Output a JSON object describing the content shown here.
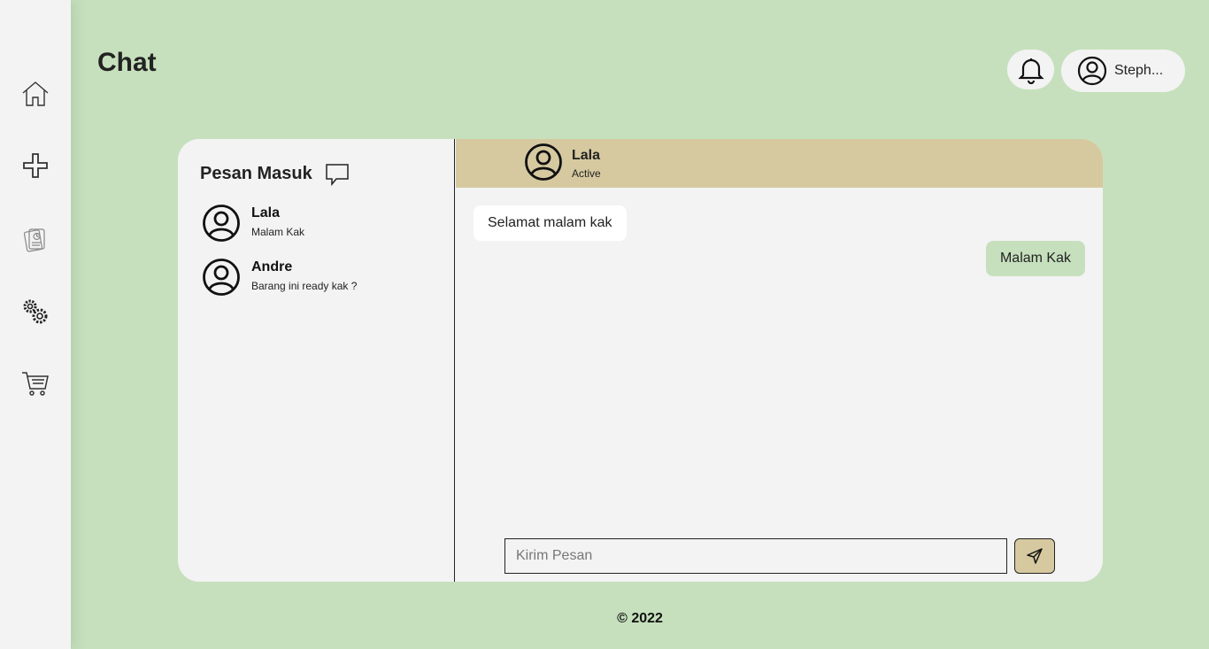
{
  "header": {
    "title": "Chat",
    "user_name": "Steph..."
  },
  "sidebar": {
    "items": [
      {
        "icon": "home-icon"
      },
      {
        "icon": "plus-icon"
      },
      {
        "icon": "orders-icon"
      },
      {
        "icon": "gear-icon"
      },
      {
        "icon": "cart-icon"
      }
    ]
  },
  "inbox": {
    "title": "Pesan Masuk",
    "conversations": [
      {
        "name": "Lala",
        "last_message": "Malam Kak"
      },
      {
        "name": "Andre",
        "last_message": "Barang ini ready kak ?"
      }
    ]
  },
  "chat": {
    "contact_name": "Lala",
    "contact_status": "Active",
    "messages": [
      {
        "direction": "in",
        "text": "Selamat malam kak"
      },
      {
        "direction": "out",
        "text": "Malam Kak"
      }
    ],
    "input_placeholder": "Kirim Pesan"
  },
  "footer": {
    "text": "© 2022"
  },
  "colors": {
    "background": "#c6e0bd",
    "panel": "#f3f3f3",
    "header_bar": "#d6c9a0",
    "outgoing_bubble": "#c6e0bd"
  }
}
